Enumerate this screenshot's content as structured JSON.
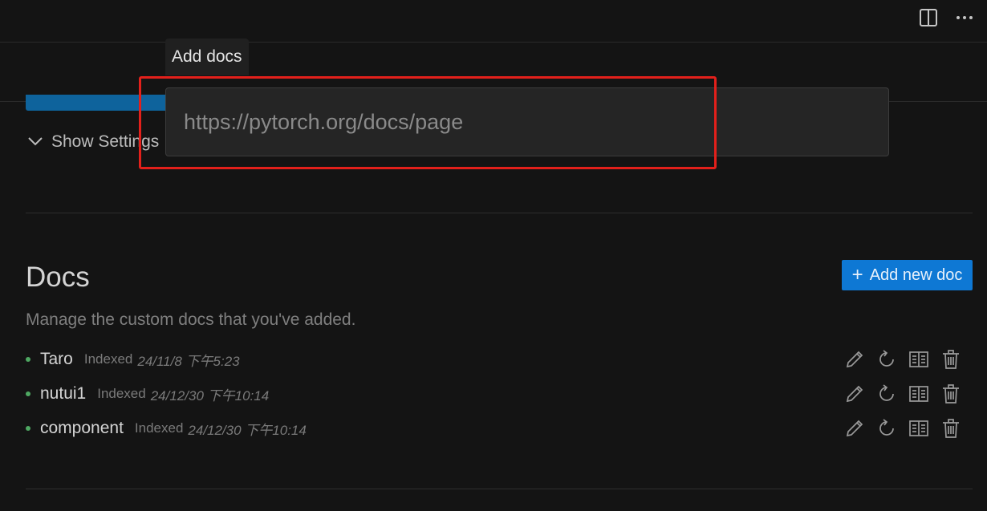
{
  "popup": {
    "title": "Add docs",
    "input_placeholder": "https://pytorch.org/docs/page",
    "input_value": ""
  },
  "settings": {
    "toggle_label": "Show Settings"
  },
  "docs": {
    "title": "Docs",
    "description": "Manage the custom docs that you've added.",
    "add_button_label": "Add new doc",
    "items": [
      {
        "name": "Taro",
        "indexed_label": "Indexed",
        "date": "24/11/8 下午5:23"
      },
      {
        "name": "nutui1",
        "indexed_label": "Indexed",
        "date": "24/12/30 下午10:14"
      },
      {
        "name": "component",
        "indexed_label": "Indexed",
        "date": "24/12/30 下午10:14"
      }
    ]
  },
  "icons": {
    "split": "split-editor-icon",
    "more": "more-icon",
    "chevron": "chevron-down-icon",
    "edit": "pencil-icon",
    "reindex": "refresh-icon",
    "open": "book-icon",
    "delete": "trash-icon"
  },
  "colors": {
    "accent": "#0e78d4",
    "highlight": "#e3201b",
    "status_dot": "#4ea862"
  }
}
